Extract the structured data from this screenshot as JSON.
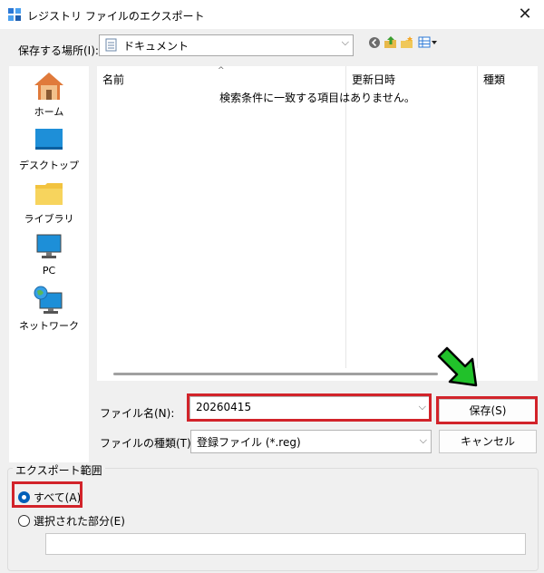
{
  "window": {
    "title": "レジストリ ファイルのエクスポート",
    "close_glyph": "✕"
  },
  "location": {
    "label": "保存する場所(I):",
    "value": "ドキュメント"
  },
  "places": [
    {
      "label": "ホーム",
      "icon": "home-icon"
    },
    {
      "label": "デスクトップ",
      "icon": "desktop-icon"
    },
    {
      "label": "ライブラリ",
      "icon": "library-icon"
    },
    {
      "label": "PC",
      "icon": "pc-icon"
    },
    {
      "label": "ネットワーク",
      "icon": "network-icon"
    }
  ],
  "filelist": {
    "columns": [
      "名前",
      "更新日時",
      "種類"
    ],
    "empty_message": "検索条件に一致する項目はありません。"
  },
  "filename": {
    "label": "ファイル名(N):",
    "value": "20260415"
  },
  "filetype": {
    "label": "ファイルの種類(T):",
    "value": "登録ファイル (*.reg)"
  },
  "buttons": {
    "save": "保存(S)",
    "cancel": "キャンセル"
  },
  "export_range": {
    "title": "エクスポート範囲",
    "options": [
      "すべて(A)",
      "選択された部分(E)"
    ],
    "selected": 0,
    "branch_value": ""
  },
  "colors": {
    "highlight": "#d2232a",
    "arrow": "#21c12a",
    "accent": "#005fb8"
  }
}
